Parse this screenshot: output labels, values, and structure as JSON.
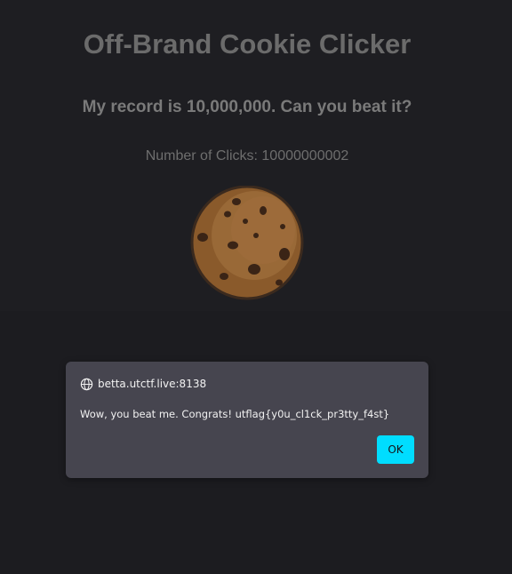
{
  "page": {
    "title": "Off-Brand Cookie Clicker",
    "subtitle": "My record is 10,000,000. Can you beat it?",
    "clicks_label": "Number of Clicks: 10000000002"
  },
  "cookie": {
    "icon": "cookie-icon",
    "colors": {
      "base": "#8a5a2b",
      "highlight": "#a06d3c",
      "chips": "#3a2416",
      "outline": "#3b2a1e"
    }
  },
  "dialog": {
    "origin": "betta.utctf.live:8138",
    "origin_icon": "globe-icon",
    "message": "Wow, you beat me. Congrats! utflag{y0u_cl1ck_pr3tty_f4st}",
    "ok_label": "OK",
    "accent_color": "#00ddff"
  }
}
